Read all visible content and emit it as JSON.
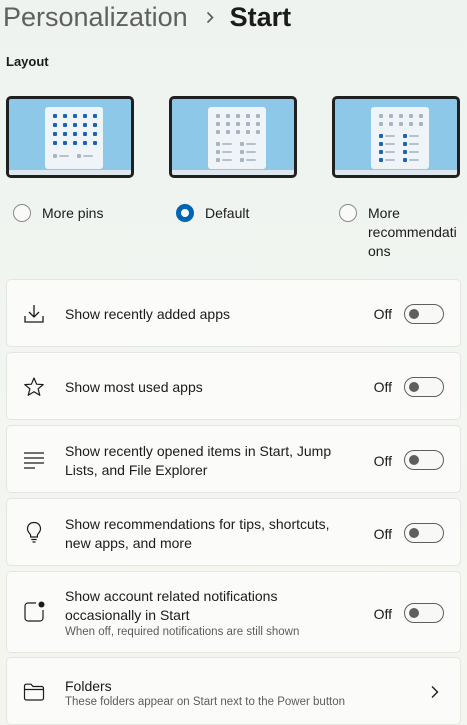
{
  "breadcrumb": {
    "parent": "Personalization",
    "separator_icon": "chevron-right-icon",
    "current": "Start"
  },
  "layout": {
    "section_label": "Layout",
    "options": [
      {
        "label": "More pins",
        "selected": false
      },
      {
        "label": "Default",
        "selected": true
      },
      {
        "label_lines": [
          "More",
          "recommendati",
          "ons"
        ],
        "selected": false
      }
    ]
  },
  "settings": [
    {
      "icon": "download-icon",
      "title": "Show recently added apps",
      "state": "Off",
      "on": false
    },
    {
      "icon": "star-icon",
      "title": "Show most used apps",
      "state": "Off",
      "on": false
    },
    {
      "icon": "list-lines-icon",
      "title_lines": [
        "Show recently opened items in Start, Jump",
        "Lists, and File Explorer"
      ],
      "state": "Off",
      "on": false
    },
    {
      "icon": "lightbulb-icon",
      "title_lines": [
        "Show recommendations for tips, shortcuts,",
        "new apps, and more"
      ],
      "state": "Off",
      "on": false
    },
    {
      "icon": "notification-badge-icon",
      "title_lines": [
        "Show account related notifications",
        "occasionally in Start"
      ],
      "description": "When off, required notifications are still shown",
      "state": "Off",
      "on": false
    }
  ],
  "folders": {
    "icon": "folder-icon",
    "title": "Folders",
    "description": "These folders appear on Start next to the Power button",
    "chevron_icon": "chevron-right-icon"
  },
  "colors": {
    "accent": "#0064b4",
    "preview_wallpaper": "#8ec8e8",
    "pin_blue": "#1a63b8"
  }
}
